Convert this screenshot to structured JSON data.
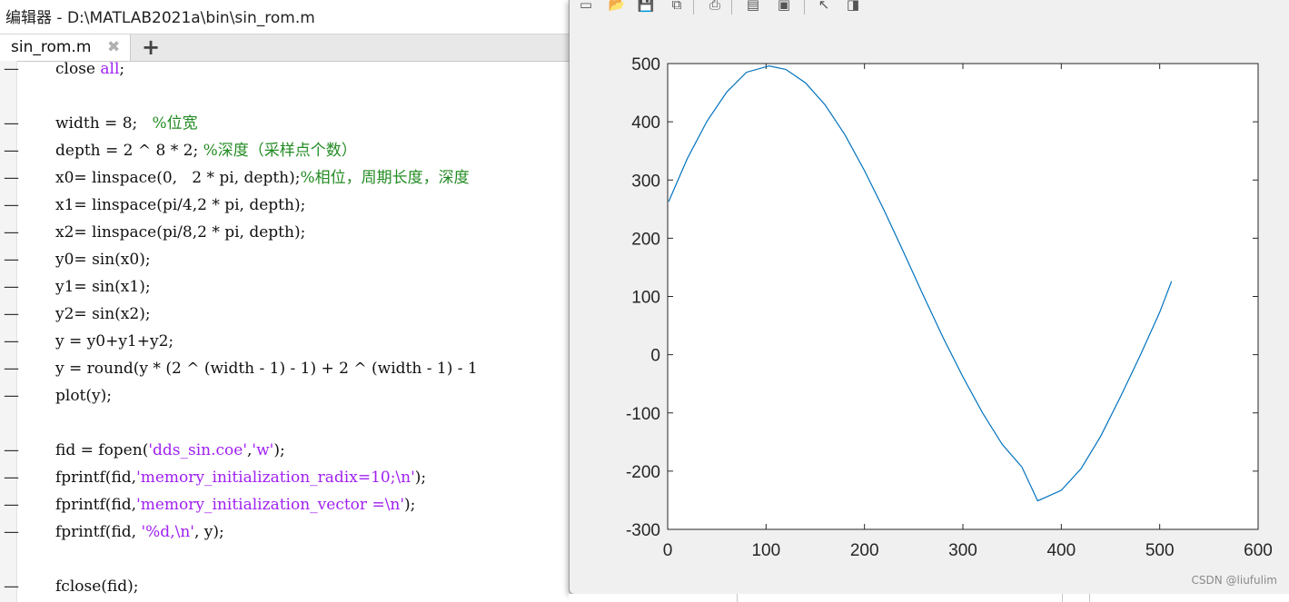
{
  "editor": {
    "title": "编辑器 - D:\\MATLAB2021a\\bin\\sin_rom.m",
    "tab": {
      "label": "sin_rom.m",
      "close_glyph": "✖"
    },
    "add_tab_glyph": "+",
    "marker_glyph": "—",
    "lines": [
      {
        "row": 0,
        "marker": true,
        "parts": [
          {
            "t": "close "
          },
          {
            "t": "all",
            "c": "str"
          },
          {
            "t": ";"
          }
        ]
      },
      {
        "row": 2,
        "marker": true,
        "parts": [
          {
            "t": "width = 8;   "
          },
          {
            "t": "%位宽",
            "c": "cmt"
          }
        ]
      },
      {
        "row": 3,
        "marker": true,
        "parts": [
          {
            "t": "depth = 2 ^ 8 * 2; "
          },
          {
            "t": "%深度（采样点个数）",
            "c": "cmt"
          }
        ]
      },
      {
        "row": 4,
        "marker": true,
        "parts": [
          {
            "t": "x0= linspace(0,   2 * pi, depth);"
          },
          {
            "t": "%相位，周期长度，深度",
            "c": "cmt"
          }
        ]
      },
      {
        "row": 5,
        "marker": true,
        "parts": [
          {
            "t": "x1= linspace(pi/4,2 * pi, depth);"
          }
        ]
      },
      {
        "row": 6,
        "marker": true,
        "parts": [
          {
            "t": "x2= linspace(pi/8,2 * pi, depth);"
          }
        ]
      },
      {
        "row": 7,
        "marker": true,
        "parts": [
          {
            "t": "y0= sin(x0);"
          }
        ]
      },
      {
        "row": 8,
        "marker": true,
        "parts": [
          {
            "t": "y1= sin(x1);"
          }
        ]
      },
      {
        "row": 9,
        "marker": true,
        "parts": [
          {
            "t": "y2= sin(x2);"
          }
        ]
      },
      {
        "row": 10,
        "marker": true,
        "parts": [
          {
            "t": "y = y0+y1+y2;"
          }
        ]
      },
      {
        "row": 11,
        "marker": true,
        "parts": [
          {
            "t": "y = round(y * (2 ^ (width - 1) - 1) + 2 ^ (width - 1) - 1"
          }
        ]
      },
      {
        "row": 12,
        "marker": true,
        "parts": [
          {
            "t": "plot(y);"
          }
        ]
      },
      {
        "row": 14,
        "marker": true,
        "parts": [
          {
            "t": "fid = fopen("
          },
          {
            "t": "'dds_sin.coe'",
            "c": "str"
          },
          {
            "t": ","
          },
          {
            "t": "'w'",
            "c": "str"
          },
          {
            "t": ");"
          }
        ]
      },
      {
        "row": 15,
        "marker": true,
        "parts": [
          {
            "t": "fprintf(fid,"
          },
          {
            "t": "'memory_initialization_radix=10;\\n'",
            "c": "str"
          },
          {
            "t": ");"
          }
        ]
      },
      {
        "row": 16,
        "marker": true,
        "parts": [
          {
            "t": "fprintf(fid,"
          },
          {
            "t": "'memory_initialization_vector =\\n'",
            "c": "str"
          },
          {
            "t": ");"
          }
        ]
      },
      {
        "row": 17,
        "marker": true,
        "parts": [
          {
            "t": "fprintf(fid, "
          },
          {
            "t": "'%d,\\n'",
            "c": "str"
          },
          {
            "t": ", y);"
          }
        ]
      },
      {
        "row": 19,
        "marker": true,
        "parts": [
          {
            "t": "fclose(fid);"
          }
        ]
      }
    ]
  },
  "figure": {
    "toolbar_icons": [
      {
        "name": "new-figure-icon",
        "glyph": "▭"
      },
      {
        "name": "open-file-icon",
        "glyph": "📂"
      },
      {
        "name": "save-icon",
        "glyph": "💾"
      },
      {
        "name": "workspace-icon",
        "glyph": "⧉"
      },
      {
        "name": "print-icon",
        "glyph": "⎙"
      },
      {
        "name": "insert-colorbar-icon",
        "glyph": "▤"
      },
      {
        "name": "insert-legend-icon",
        "glyph": "▣"
      },
      {
        "name": "select-pointer-icon",
        "glyph": "↖"
      },
      {
        "name": "property-editor-icon",
        "glyph": "◨"
      }
    ]
  },
  "chart_data": {
    "type": "line",
    "title": "",
    "xlabel": "",
    "ylabel": "",
    "xlim": [
      0,
      600
    ],
    "ylim": [
      -300,
      500
    ],
    "xticks": [
      0,
      100,
      200,
      300,
      400,
      500,
      600
    ],
    "yticks": [
      -300,
      -200,
      -100,
      0,
      100,
      200,
      300,
      400,
      500
    ],
    "grid": false,
    "line_color": "#0072BD",
    "series": [
      {
        "x": [
          1,
          20,
          40,
          60,
          80,
          103,
          120,
          140,
          160,
          180,
          200,
          220,
          240,
          260,
          280,
          300,
          320,
          340,
          360,
          376,
          400,
          420,
          440,
          460,
          480,
          500,
          512
        ],
        "values": [
          263,
          337,
          401,
          451,
          485,
          496,
          490,
          467,
          429,
          378,
          316,
          248,
          175,
          101,
          29,
          -38,
          -100,
          -154,
          -193,
          -251,
          -233,
          -196,
          -140,
          -73,
          -2,
          73,
          126
        ]
      }
    ]
  },
  "watermark": "CSDN @liufulim"
}
